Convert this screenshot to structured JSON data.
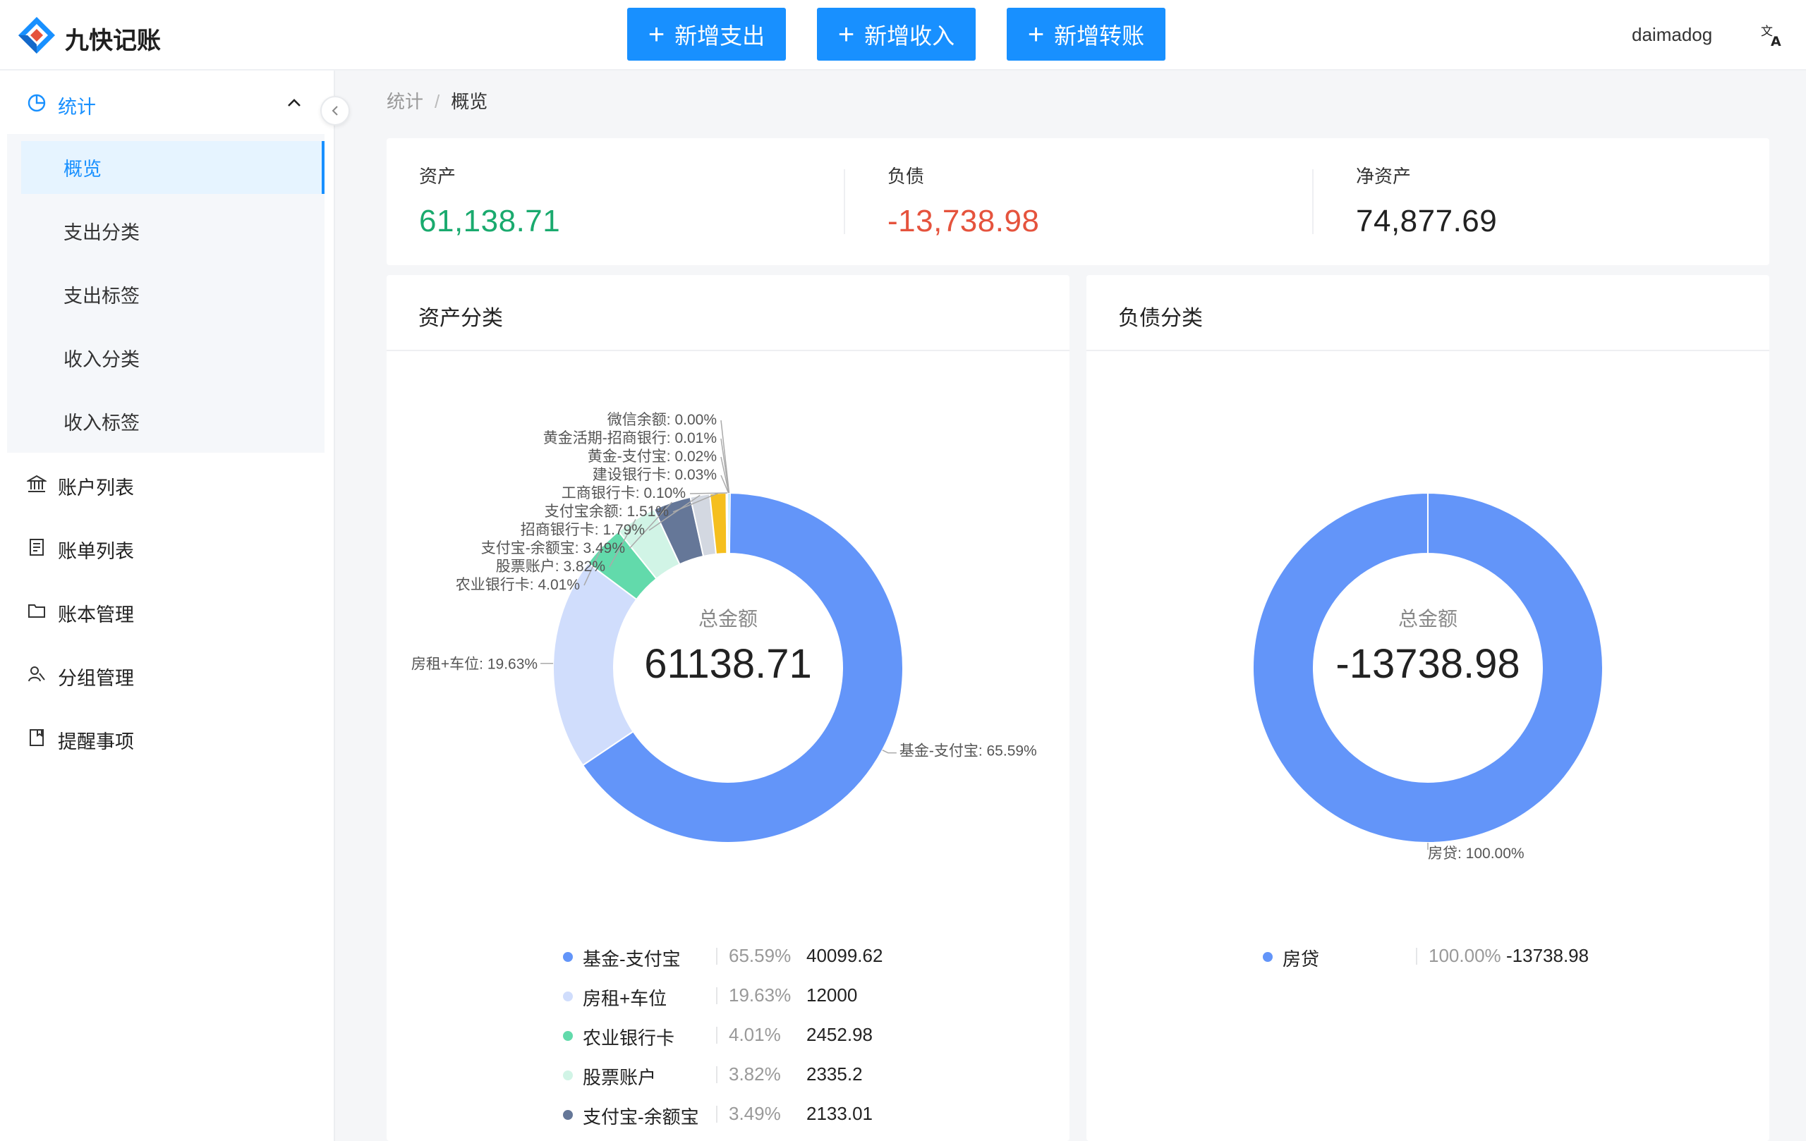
{
  "app": {
    "name": "九快记账"
  },
  "header": {
    "buttons": [
      {
        "label": "新增支出"
      },
      {
        "label": "新增收入"
      },
      {
        "label": "新增转账"
      }
    ],
    "username": "daimadog"
  },
  "sidebar": {
    "group": {
      "label": "统计"
    },
    "subitems": [
      {
        "label": "概览",
        "active": true
      },
      {
        "label": "支出分类"
      },
      {
        "label": "支出标签"
      },
      {
        "label": "收入分类"
      },
      {
        "label": "收入标签"
      }
    ],
    "items": [
      {
        "label": "账户列表",
        "icon": "bank-icon"
      },
      {
        "label": "账单列表",
        "icon": "bill-icon"
      },
      {
        "label": "账本管理",
        "icon": "folder-icon"
      },
      {
        "label": "分组管理",
        "icon": "group-icon"
      },
      {
        "label": "提醒事项",
        "icon": "reminder-icon"
      }
    ]
  },
  "breadcrumb": {
    "parent": "统计",
    "separator": "/",
    "current": "概览"
  },
  "summary": {
    "assets": {
      "label": "资产",
      "value": "61,138.71",
      "color": "#1aaa6e"
    },
    "liabilities": {
      "label": "负债",
      "value": "-13,738.98",
      "color": "#e5533d"
    },
    "net": {
      "label": "净资产",
      "value": "74,877.69",
      "color": "#222222"
    }
  },
  "colors": {
    "primary": "#1890ff"
  },
  "asset_card": {
    "title": "资产分类",
    "center_label": "总金额",
    "center_value": "61138.71",
    "legend": [
      {
        "name": "基金-支付宝",
        "pct": "65.59%",
        "value": "40099.62",
        "color": "#6395f9"
      },
      {
        "name": "房租+车位",
        "pct": "19.63%",
        "value": "12000",
        "color": "#d0ddfc"
      },
      {
        "name": "农业银行卡",
        "pct": "4.01%",
        "value": "2452.98",
        "color": "#62daab"
      },
      {
        "name": "股票账户",
        "pct": "3.82%",
        "value": "2335.2",
        "color": "#d1f4e6"
      },
      {
        "name": "支付宝-余额宝",
        "pct": "3.49%",
        "value": "2133.01",
        "color": "#657798"
      }
    ]
  },
  "liability_card": {
    "title": "负债分类",
    "center_label": "总金额",
    "center_value": "-13738.98",
    "legend": [
      {
        "name": "房贷",
        "pct": "100.00%",
        "value": "-13738.98",
        "color": "#6395f9"
      }
    ]
  },
  "chart_data": [
    {
      "type": "pie",
      "title": "资产分类",
      "donut": true,
      "total_label": "总金额",
      "total": 61138.71,
      "slices": [
        {
          "name": "基金-支付宝",
          "value": 40099.62,
          "percent": 65.59,
          "label": "基金-支付宝: 65.59%",
          "color": "#6395f9"
        },
        {
          "name": "房租+车位",
          "value": 12000,
          "percent": 19.63,
          "label": "房租+车位: 19.63%",
          "color": "#d0ddfc"
        },
        {
          "name": "农业银行卡",
          "value": 2452.98,
          "percent": 4.01,
          "label": "农业银行卡: 4.01%",
          "color": "#62daab"
        },
        {
          "name": "股票账户",
          "value": 2335.2,
          "percent": 3.82,
          "label": "股票账户: 3.82%",
          "color": "#d1f4e6"
        },
        {
          "name": "支付宝-余额宝",
          "value": 2133.01,
          "percent": 3.49,
          "label": "支付宝-余额宝: 3.49%",
          "color": "#657798"
        },
        {
          "name": "招商银行卡",
          "value": 1094.38,
          "percent": 1.79,
          "label": "招商银行卡: 1.79%",
          "color": "#d3d8e1"
        },
        {
          "name": "支付宝余额",
          "value": 923.2,
          "percent": 1.51,
          "label": "支付宝余额: 1.51%",
          "color": "#f5bf1e"
        },
        {
          "name": "工商银行卡",
          "value": 61.14,
          "percent": 0.1,
          "label": "工商银行卡: 0.10%",
          "color": "#fbe7a5"
        },
        {
          "name": "建设银行卡",
          "value": 18.34,
          "percent": 0.03,
          "label": "建设银行卡: 0.03%",
          "color": "#7262fd"
        },
        {
          "name": "黄金-支付宝",
          "value": 12.23,
          "percent": 0.02,
          "label": "黄金-支付宝: 0.02%",
          "color": "#d5d0fe"
        },
        {
          "name": "黄金活期-招商银行",
          "value": 6.11,
          "percent": 0.01,
          "label": "黄金活期-招商银行: 0.01%",
          "color": "#78d3f8"
        },
        {
          "name": "微信余额",
          "value": 0,
          "percent": 0.0,
          "label": "微信余额: 0.00%",
          "color": "#d2edfd"
        }
      ]
    },
    {
      "type": "pie",
      "title": "负债分类",
      "donut": true,
      "total_label": "总金额",
      "total": -13738.98,
      "slices": [
        {
          "name": "房贷",
          "value": -13738.98,
          "percent": 100.0,
          "label": "房贷: 100.00%",
          "color": "#6395f9"
        }
      ]
    }
  ]
}
